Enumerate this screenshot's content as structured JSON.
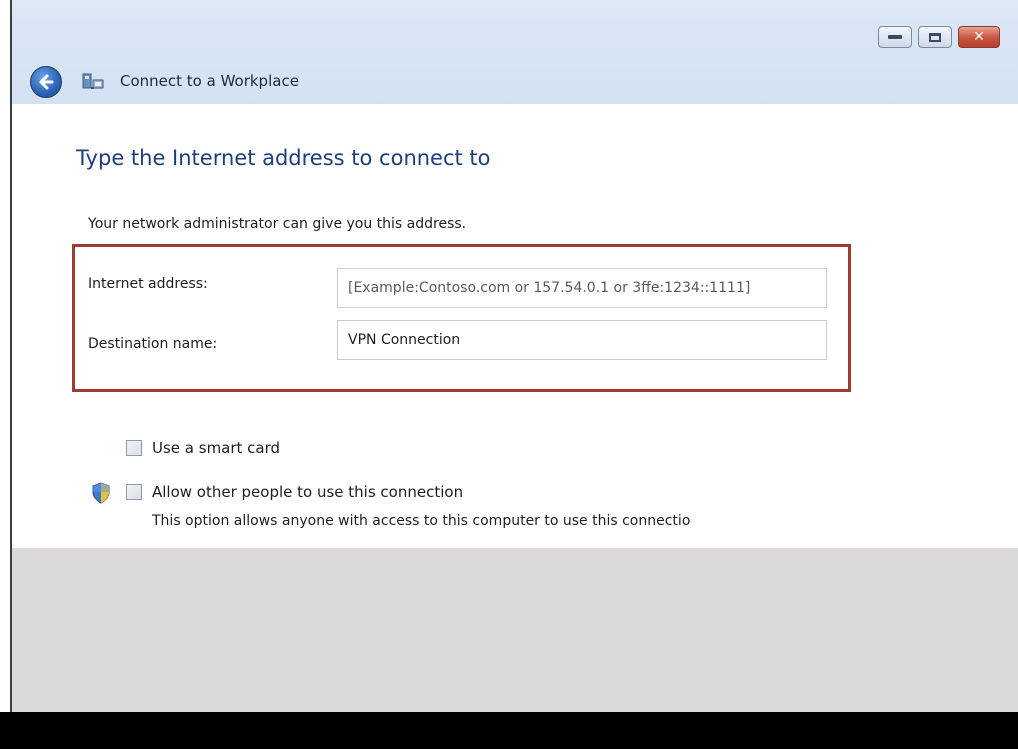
{
  "window": {
    "title": "Connect to a Workplace",
    "caption_buttons": [
      "minimize",
      "maximize",
      "close"
    ]
  },
  "main": {
    "heading": "Type the Internet address to connect to",
    "description": "Your network administrator can give you this address.",
    "fields": {
      "internet_address": {
        "label": "Internet address:",
        "placeholder": "[Example:Contoso.com or 157.54.0.1 or 3ffe:1234::1111]",
        "value": ""
      },
      "destination_name": {
        "label": "Destination name:",
        "value": "VPN Connection"
      }
    },
    "options": {
      "smart_card": {
        "label": "Use a smart card",
        "checked": false
      },
      "allow_others": {
        "label": "Allow other people to use this connection",
        "checked": false,
        "note": "This option allows anyone with access to this computer to use this connectio"
      }
    }
  },
  "icons": {
    "back": "back-arrow-icon",
    "app": "network-connection-icon",
    "shield": "uac-shield-icon"
  },
  "colors": {
    "heading": "#1c3f7c",
    "highlight_border": "#a0392f",
    "titlebar": "#dde8f5",
    "lower_area": "#dbd9da"
  }
}
